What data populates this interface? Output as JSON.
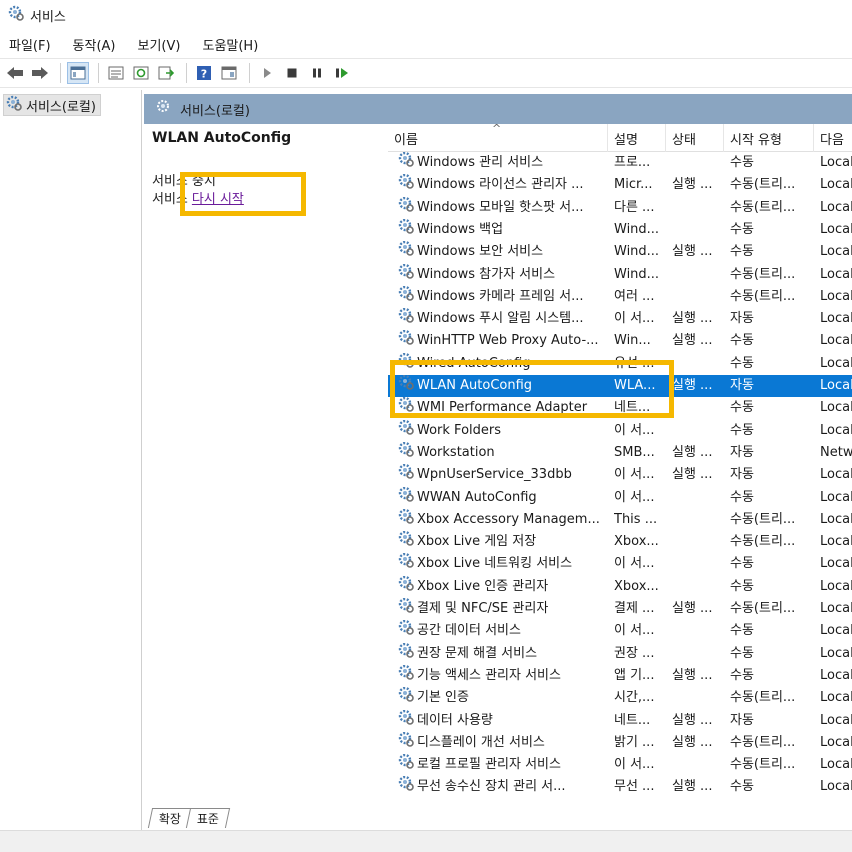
{
  "window": {
    "title": "서비스"
  },
  "menu": {
    "items": [
      "파일(F)",
      "동작(A)",
      "보기(V)",
      "도움말(H)"
    ]
  },
  "tree": {
    "item": "서비스(로컬)"
  },
  "main": {
    "header": "서비스(로컬)"
  },
  "detail": {
    "title": "WLAN AutoConfig",
    "line1": "서비스 중지",
    "prefix": "서비스",
    "restart_link": "다시 시작"
  },
  "columns": {
    "name": "이름",
    "desc": "설명",
    "status": "상태",
    "start": "시작 유형",
    "logon": "다음"
  },
  "rows": [
    {
      "name": "Windows 관리 서비스",
      "desc": "프로...",
      "status": "",
      "start": "수동",
      "logon": "Local"
    },
    {
      "name": "Windows 라이선스 관리자 ...",
      "desc": "Micr...",
      "status": "실행 ...",
      "start": "수동(트리...",
      "logon": "Local"
    },
    {
      "name": "Windows 모바일 핫스팟 서...",
      "desc": "다른 ...",
      "status": "",
      "start": "수동(트리...",
      "logon": "Local"
    },
    {
      "name": "Windows 백업",
      "desc": "Wind...",
      "status": "",
      "start": "수동",
      "logon": "Local"
    },
    {
      "name": "Windows 보안 서비스",
      "desc": "Wind...",
      "status": "실행 ...",
      "start": "수동",
      "logon": "Local"
    },
    {
      "name": "Windows 참가자 서비스",
      "desc": "Wind...",
      "status": "",
      "start": "수동(트리...",
      "logon": "Local"
    },
    {
      "name": "Windows 카메라 프레임 서...",
      "desc": "여러 ...",
      "status": "",
      "start": "수동(트리...",
      "logon": "Local"
    },
    {
      "name": "Windows 푸시 알림 시스템...",
      "desc": "이 서...",
      "status": "실행 ...",
      "start": "자동",
      "logon": "Local"
    },
    {
      "name": "WinHTTP Web Proxy Auto-...",
      "desc": "Win...",
      "status": "실행 ...",
      "start": "수동",
      "logon": "Local"
    },
    {
      "name": "Wired AutoConfig",
      "desc": "유선 ...",
      "status": "",
      "start": "수동",
      "logon": "Local"
    },
    {
      "name": "WLAN AutoConfig",
      "desc": "WLA...",
      "status": "실행 ...",
      "start": "자동",
      "logon": "Local",
      "selected": true
    },
    {
      "name": "WMI Performance Adapter",
      "desc": "네트...",
      "status": "",
      "start": "수동",
      "logon": "Local"
    },
    {
      "name": "Work Folders",
      "desc": "이 서...",
      "status": "",
      "start": "수동",
      "logon": "Local"
    },
    {
      "name": "Workstation",
      "desc": "SMB...",
      "status": "실행 ...",
      "start": "자동",
      "logon": "Netw"
    },
    {
      "name": "WpnUserService_33dbb",
      "desc": "이 서...",
      "status": "실행 ...",
      "start": "자동",
      "logon": "Local"
    },
    {
      "name": "WWAN AutoConfig",
      "desc": "이 서...",
      "status": "",
      "start": "수동",
      "logon": "Local"
    },
    {
      "name": "Xbox Accessory Managem...",
      "desc": "This ...",
      "status": "",
      "start": "수동(트리...",
      "logon": "Local"
    },
    {
      "name": "Xbox Live 게임 저장",
      "desc": "Xbox...",
      "status": "",
      "start": "수동(트리...",
      "logon": "Local"
    },
    {
      "name": "Xbox Live 네트워킹 서비스",
      "desc": "이 서...",
      "status": "",
      "start": "수동",
      "logon": "Local"
    },
    {
      "name": "Xbox Live 인증 관리자",
      "desc": "Xbox...",
      "status": "",
      "start": "수동",
      "logon": "Local"
    },
    {
      "name": "결제 및 NFC/SE 관리자",
      "desc": "결제 ...",
      "status": "실행 ...",
      "start": "수동(트리...",
      "logon": "Local"
    },
    {
      "name": "공간 데이터 서비스",
      "desc": "이 서...",
      "status": "",
      "start": "수동",
      "logon": "Local"
    },
    {
      "name": "권장 문제 해결 서비스",
      "desc": "권장 ...",
      "status": "",
      "start": "수동",
      "logon": "Local"
    },
    {
      "name": "기능 액세스 관리자 서비스",
      "desc": "앱 기...",
      "status": "실행 ...",
      "start": "수동",
      "logon": "Local"
    },
    {
      "name": "기본 인증",
      "desc": "시간,...",
      "status": "",
      "start": "수동(트리...",
      "logon": "Local"
    },
    {
      "name": "데이터 사용량",
      "desc": "네트...",
      "status": "실행 ...",
      "start": "자동",
      "logon": "Local"
    },
    {
      "name": "디스플레이 개선 서비스",
      "desc": "밝기 ...",
      "status": "실행 ...",
      "start": "수동(트리...",
      "logon": "Local"
    },
    {
      "name": "로컬 프로필 관리자 서비스",
      "desc": "이 서...",
      "status": "",
      "start": "수동(트리...",
      "logon": "Local"
    },
    {
      "name": "무선 송수신 장치 관리 서...",
      "desc": "무선 ...",
      "status": "실행 ...",
      "start": "수동",
      "logon": "Local"
    }
  ],
  "tabs": [
    "확장",
    "표준"
  ],
  "colors": {
    "selection": "#0a78d4",
    "highlight": "#f5b800",
    "header": "#8aa5c1",
    "link": "#6a1b9a"
  }
}
